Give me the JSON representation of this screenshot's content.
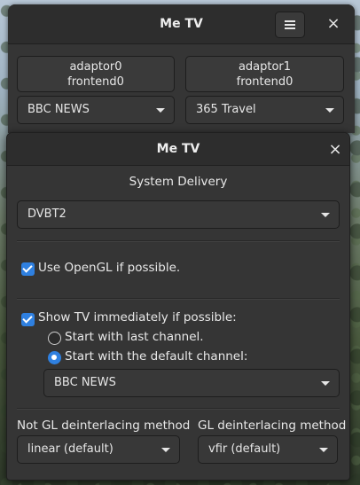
{
  "main_window": {
    "title": "Me TV",
    "menu_icon": "hamburger-menu-icon",
    "close_icon": "close-icon",
    "adapters": [
      {
        "adaptor": "adaptor0",
        "frontend": "frontend0",
        "channel": "BBC NEWS"
      },
      {
        "adaptor": "adaptor1",
        "frontend": "frontend0",
        "channel": "365 Travel"
      }
    ]
  },
  "preferences": {
    "title": "Me TV",
    "close_icon": "close-icon",
    "system_delivery_label": "System Delivery",
    "system_delivery_value": "DVBT2",
    "use_opengl": {
      "label": "Use OpenGL if possible.",
      "checked": true
    },
    "show_tv": {
      "label": "Show TV immediately if possible:",
      "checked": true
    },
    "start_last": {
      "label": "Start with last channel.",
      "selected": false
    },
    "start_default": {
      "label": "Start with the default channel:",
      "selected": true
    },
    "default_channel": "BBC NEWS",
    "not_gl_label": "Not GL deinterlacing method",
    "not_gl_value": "linear (default)",
    "gl_label": "GL deinterlacing method",
    "gl_value": "vfir (default)"
  },
  "colors": {
    "accent": "#2f80e0",
    "window_bg": "#353535",
    "titlebar_bg": "#2d2d2d"
  }
}
